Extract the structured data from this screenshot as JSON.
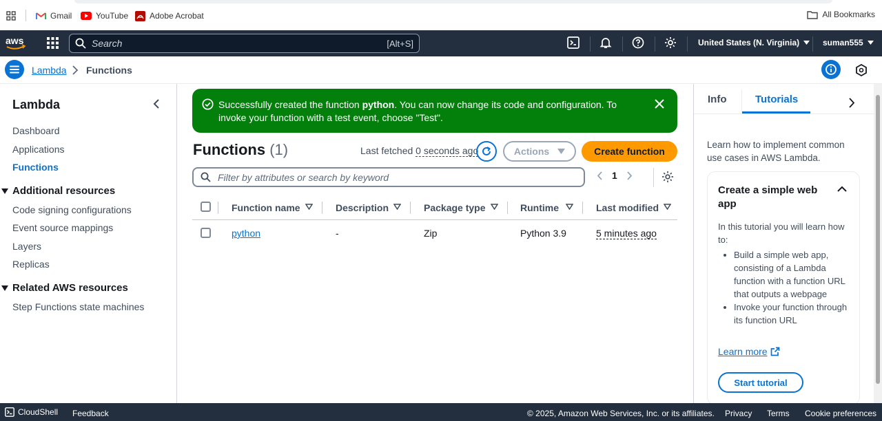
{
  "bookmarks": {
    "items": [
      {
        "label": "Gmail",
        "icon": "gmail-icon"
      },
      {
        "label": "YouTube",
        "icon": "youtube-icon"
      },
      {
        "label": "Adobe Acrobat",
        "icon": "acrobat-icon"
      }
    ],
    "all_bookmarks": "All Bookmarks"
  },
  "topnav": {
    "logo": "aws",
    "search_placeholder": "Search",
    "search_shortcut": "[Alt+S]",
    "region": "United States (N. Virginia)",
    "user": "suman555"
  },
  "breadcrumb": {
    "root": "Lambda",
    "current": "Functions"
  },
  "sidebar": {
    "title": "Lambda",
    "links": [
      "Dashboard",
      "Applications",
      "Functions"
    ],
    "active": "Functions",
    "additional_resources": {
      "title": "Additional resources",
      "links": [
        "Code signing configurations",
        "Event source mappings",
        "Layers",
        "Replicas"
      ]
    },
    "related_resources": {
      "title": "Related AWS resources",
      "links": [
        "Step Functions state machines"
      ]
    }
  },
  "flash": {
    "prefix": "Successfully created the function ",
    "function_name": "python",
    "suffix": ". You can now change its code and configuration. To invoke your function with a test event, choose \"Test\"."
  },
  "functions": {
    "heading": "Functions",
    "count": "(1)",
    "last_fetched_label": "Last fetched",
    "last_fetched_value": "0 seconds ago",
    "actions_label": "Actions",
    "create_label": "Create function",
    "filter_placeholder": "Filter by attributes or search by keyword",
    "page": "1",
    "columns": [
      "Function name",
      "Description",
      "Package type",
      "Runtime",
      "Last modified"
    ],
    "rows": [
      {
        "name": "python",
        "description": "-",
        "package_type": "Zip",
        "runtime": "Python 3.9",
        "last_modified": "5 minutes ago"
      }
    ]
  },
  "help_panel": {
    "tab_info": "Info",
    "tab_tutorials": "Tutorials",
    "intro": "Learn how to implement common use cases in AWS Lambda.",
    "card_title": "Create a simple web app",
    "card_intro": "In this tutorial you will learn how to:",
    "card_bullets": [
      "Build a simple web app, consisting of a Lambda function with a function URL that outputs a webpage",
      "Invoke your function through its function URL"
    ],
    "learn_more": "Learn more",
    "start_tutorial": "Start tutorial"
  },
  "footer": {
    "cloudshell": "CloudShell",
    "feedback": "Feedback",
    "copyright": "© 2025, Amazon Web Services, Inc. or its affiliates.",
    "privacy": "Privacy",
    "terms": "Terms",
    "cookies": "Cookie preferences"
  },
  "colors": {
    "aws_nav": "#232f3e",
    "link_blue": "#0972d3",
    "success_green": "#037f0c",
    "primary_orange": "#ff9900"
  }
}
